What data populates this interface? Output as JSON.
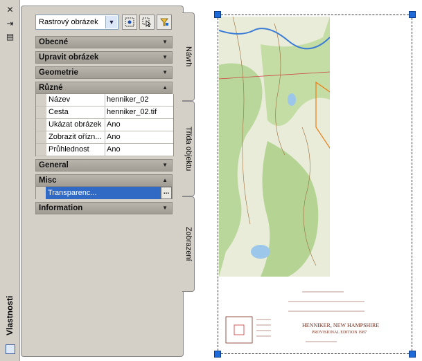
{
  "strip": {
    "title": "Vlastnosti",
    "icons": [
      "close-icon",
      "auto-hide-icon",
      "properties-menu-icon"
    ]
  },
  "toolbar": {
    "selected_type": "Rastrový obrázek",
    "buttons": [
      "quick-select-icon",
      "select-objects-icon",
      "toggle-pickadd-icon"
    ]
  },
  "sections": {
    "obecne": "Obecné",
    "upravit": "Upravit obrázek",
    "geometrie": "Geometrie",
    "ruzne": "Různé",
    "general": "General",
    "misc": "Misc",
    "information": "Information"
  },
  "properties": [
    {
      "name": "Název",
      "value": "henniker_02"
    },
    {
      "name": "Cesta",
      "value": "henniker_02.tif"
    },
    {
      "name": "Ukázat obrázek",
      "value": "Ano"
    },
    {
      "name": "Zobrazit ořízn...",
      "value": "Ano"
    },
    {
      "name": "Průhlednost",
      "value": "Ano"
    }
  ],
  "misc_property": {
    "name": "Transparenc...",
    "button": "..."
  },
  "tabs": [
    "Návrh",
    "Třída objektu",
    "Zobrazení"
  ],
  "map_legend": {
    "title": "HENNIKER, NEW HAMPSHIRE",
    "subtitle": "PROVISIONAL EDITION 1987"
  },
  "colors": {
    "panel_bg": "#d4d0c8",
    "selection": "#316ac5",
    "grip": "#1e6ad8",
    "boundary_orange": "#f07a10",
    "parcel_magenta": "#e020d0",
    "map_green": "#b9d79a"
  }
}
